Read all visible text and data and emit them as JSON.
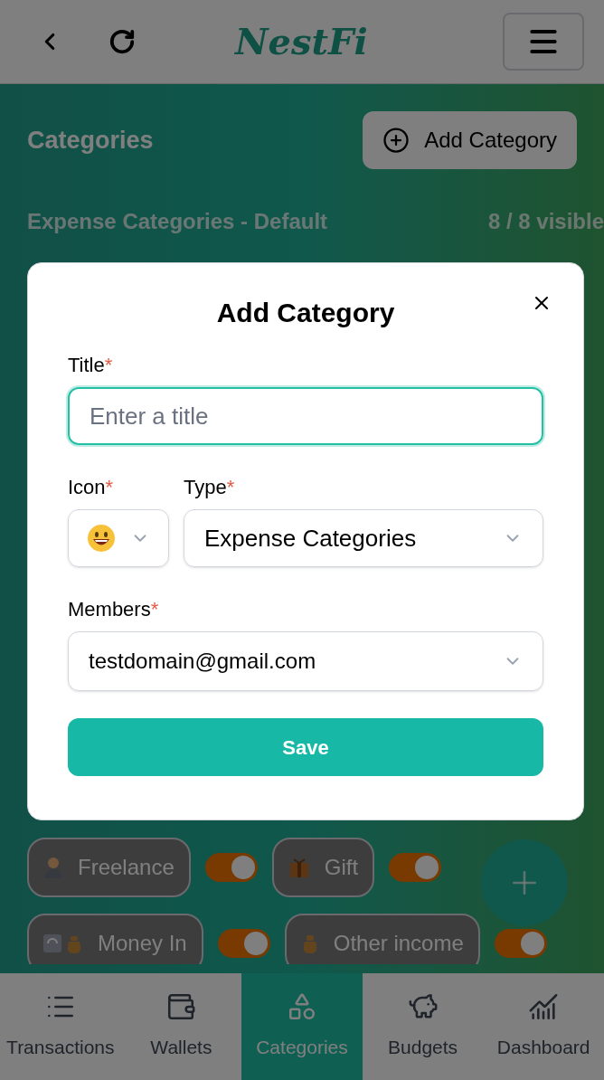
{
  "header": {
    "logo": "NestFi"
  },
  "page": {
    "title": "Categories",
    "add_button": "Add Category"
  },
  "section": {
    "title": "Expense Categories - Default",
    "count": "8 / 8 visible"
  },
  "categories": [
    {
      "label": "Freelance",
      "on": true
    },
    {
      "label": "Gift",
      "on": true
    },
    {
      "label": "Money In",
      "on": true
    },
    {
      "label": "Other income",
      "on": true
    }
  ],
  "modal": {
    "title": "Add Category",
    "title_field": {
      "label": "Title",
      "marker": "*",
      "placeholder": "Enter a title",
      "focused": true
    },
    "icon_field": {
      "label": "Icon",
      "marker": "*"
    },
    "type_field": {
      "label": "Type",
      "marker": "*",
      "value": "Expense Categories"
    },
    "members_field": {
      "label": "Members",
      "marker": "*",
      "value": "testdomain@gmail.com"
    },
    "save": "Save"
  },
  "nav": [
    {
      "label": "Transactions",
      "selected": false
    },
    {
      "label": "Wallets",
      "selected": false
    },
    {
      "label": "Categories",
      "selected": true
    },
    {
      "label": "Budgets",
      "selected": false
    },
    {
      "label": "Dashboard",
      "selected": false
    }
  ]
}
